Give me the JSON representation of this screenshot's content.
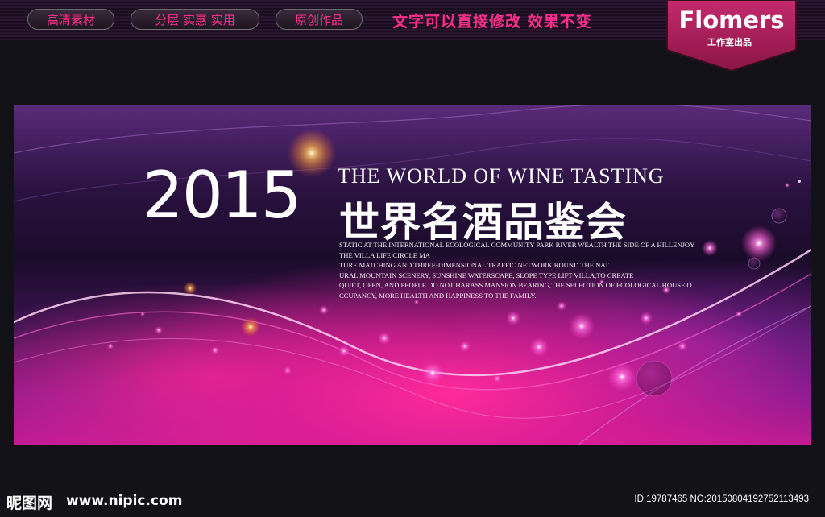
{
  "header": {
    "tags": [
      "高清素材",
      "分层 实惠 实用",
      "原创作品"
    ],
    "slogan": "文字可以直接修改  效果不变",
    "brand": {
      "name": "Flomers",
      "subtitle": "工作室出品"
    }
  },
  "banner": {
    "year": "2015",
    "english_title": "THE WORLD OF WINE TASTING",
    "chinese_title": "世界名酒品鉴会",
    "body_lines": [
      "STATIC AT THE INTERNATIONAL ECOLOGICAL COMMUNITY PARK RIVER WEALTH THE SIDE OF A HILLENJOY",
      "THE VILLA LIFE CIRCLE MA",
      "TURE MATCHING AND THREE-DIMENSIONAL TRAFFIC NETWORK,ROUND THE NAT",
      "URAL MOUNTAIN SCENERY, SUNSHINE WATERSCAPE, SLOPE TYPE LIFT VILLA,TO CREATE",
      "QUIET, OPEN, AND PEOPLE DO NOT HARASS MANSION BEARING,THE SELECTION OF ECOLOGICAL HOUSE O",
      "CCUPANCY, MORE HEALTH AND HAPPINESS TO THE FAMILY."
    ]
  },
  "footer": {
    "site_logo": "昵图网",
    "site_url": "www.nipic.com",
    "image_id": "ID:19787465 NO:20150804192752113493"
  },
  "colors": {
    "accent_pink": "#ff2e8a",
    "banner_magenta": "#c31b95",
    "badge": "#b0205e"
  }
}
